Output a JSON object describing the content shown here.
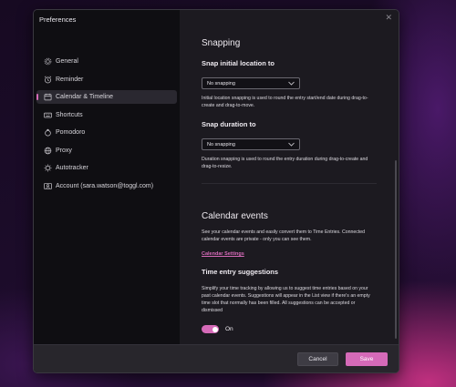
{
  "window": {
    "title": "Preferences",
    "close_glyph": "✕"
  },
  "sidebar": {
    "items": [
      {
        "label": "General",
        "icon": "gear-icon",
        "active": false
      },
      {
        "label": "Reminder",
        "icon": "alarm-clock-icon",
        "active": false
      },
      {
        "label": "Calendar & Timeline",
        "icon": "calendar-icon",
        "active": true
      },
      {
        "label": "Shortcuts",
        "icon": "keyboard-icon",
        "active": false
      },
      {
        "label": "Pomodoro",
        "icon": "pomodoro-icon",
        "active": false
      },
      {
        "label": "Proxy",
        "icon": "globe-icon",
        "active": false
      },
      {
        "label": "Autotracker",
        "icon": "autotracker-icon",
        "active": false
      },
      {
        "label": "Account (sara.watson@toggl.com)",
        "icon": "account-icon",
        "active": false
      }
    ]
  },
  "snapping": {
    "title": "Snapping",
    "location": {
      "label": "Snap initial location to",
      "value": "No snapping",
      "desc": "Initial location snapping is used to round the entry start/end date during drag-to-create and drag-to-move."
    },
    "duration": {
      "label": "Snap duration to",
      "value": "No snapping",
      "desc": "Duration snapping is used to round the entry duration during drag-to-create and drag-to-resize."
    }
  },
  "calendar": {
    "title": "Calendar events",
    "desc": "See your calendar events and easily convert them to Time Entries. Connected calendar events are private - only you can see them.",
    "settings_link": "Calendar Settings"
  },
  "suggestions": {
    "title": "Time entry suggestions",
    "desc": "Simplify your time tracking by allowing us to suggest time entries based on your past calendar events. Suggestions will appear in the List view if there's an empty time slot that normally has been filled. All suggestions can be accepted or dismissed",
    "toggle_label": "On",
    "enabled": true
  },
  "footer": {
    "cancel_label": "Cancel",
    "save_label": "Save"
  },
  "colors": {
    "accent": "#d56ab8",
    "panel": "#1c1a20",
    "sidebar": "#0f0e12",
    "footer": "#28262c"
  }
}
